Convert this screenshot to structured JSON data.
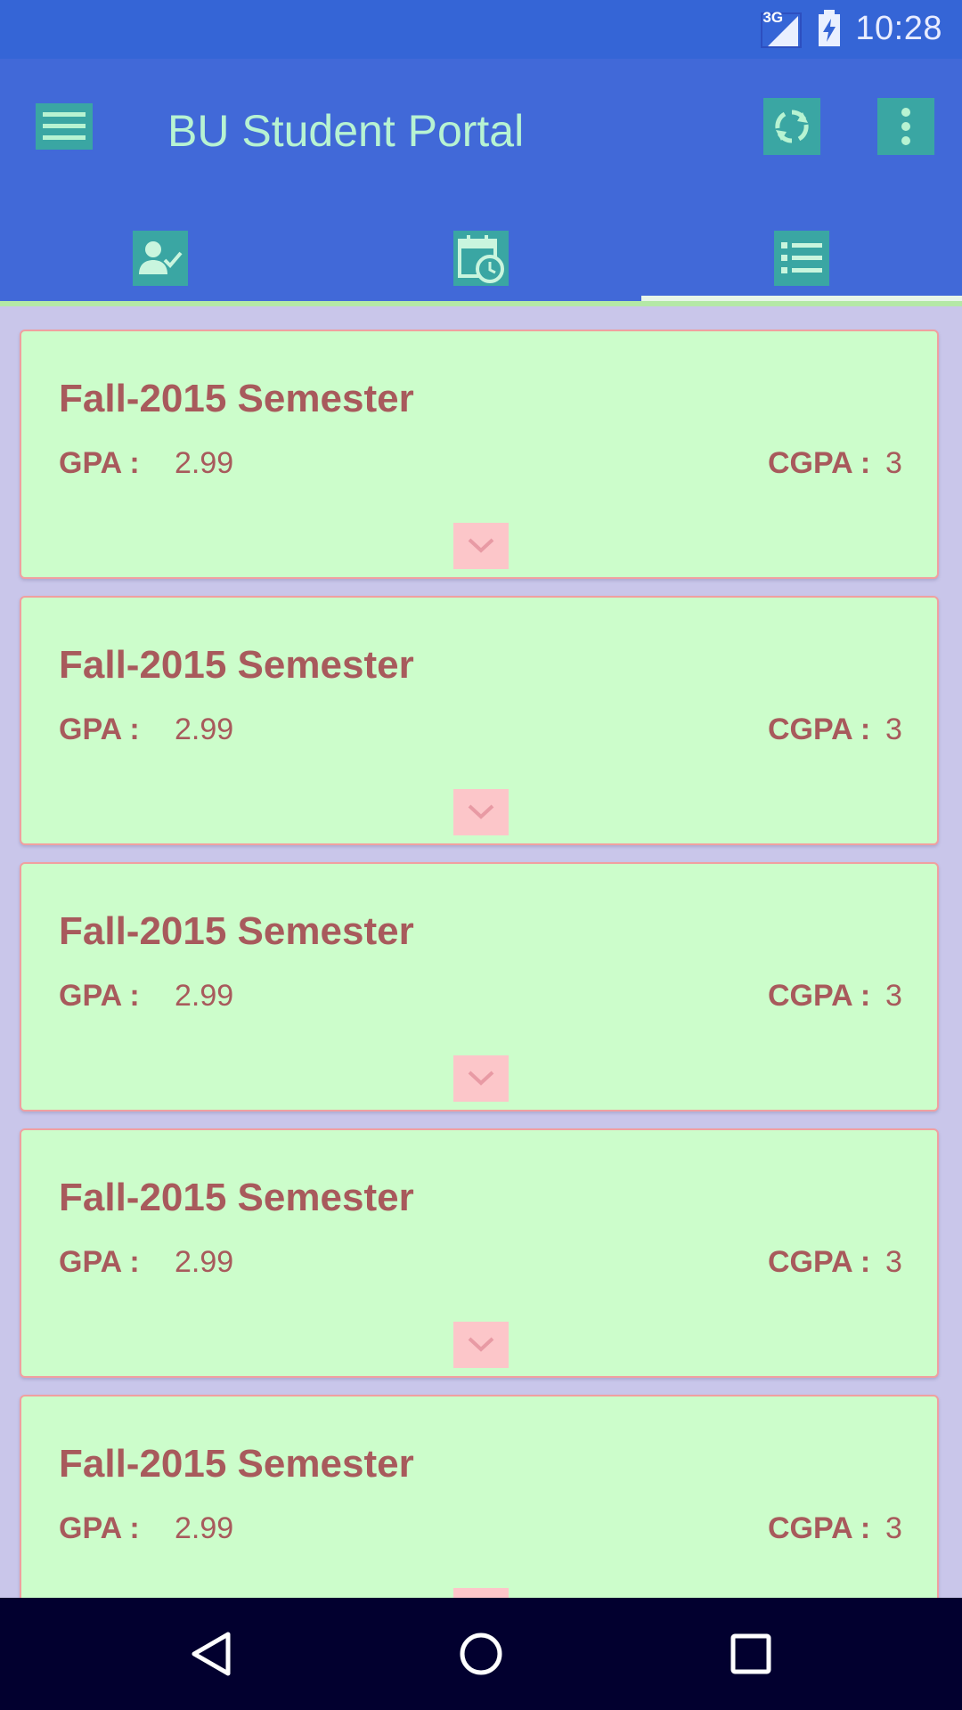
{
  "status_bar": {
    "network_type": "3G",
    "time": "10:28"
  },
  "app_bar": {
    "title": "BU Student Portal",
    "icons": {
      "menu": "menu-icon",
      "sync": "sync-icon",
      "more": "more-vert-icon"
    }
  },
  "tabs": [
    {
      "icon": "profile-check-icon",
      "selected": false
    },
    {
      "icon": "calendar-clock-icon",
      "selected": false
    },
    {
      "icon": "list-icon",
      "selected": true
    }
  ],
  "semesters": [
    {
      "title": "Fall-2015 Semester",
      "gpa_label": "GPA :",
      "gpa": "2.99",
      "cgpa_label": "CGPA :",
      "cgpa": "3"
    },
    {
      "title": "Fall-2015 Semester",
      "gpa_label": "GPA :",
      "gpa": "2.99",
      "cgpa_label": "CGPA :",
      "cgpa": "3"
    },
    {
      "title": "Fall-2015 Semester",
      "gpa_label": "GPA :",
      "gpa": "2.99",
      "cgpa_label": "CGPA :",
      "cgpa": "3"
    },
    {
      "title": "Fall-2015 Semester",
      "gpa_label": "GPA :",
      "gpa": "2.99",
      "cgpa_label": "CGPA :",
      "cgpa": "3"
    },
    {
      "title": "Fall-2015 Semester",
      "gpa_label": "GPA :",
      "gpa": "2.99",
      "cgpa_label": "CGPA :",
      "cgpa": "3"
    }
  ],
  "colors": {
    "status_bar": "#3565d6",
    "app_bar": "#4169d8",
    "icon_bg": "#3aa6a3",
    "title_text": "#b7f3d2",
    "card_bg": "#ccfdcb",
    "card_text": "#a85a5c",
    "expand_bg": "#fcc6c9",
    "nav_bar": "#02002f"
  }
}
